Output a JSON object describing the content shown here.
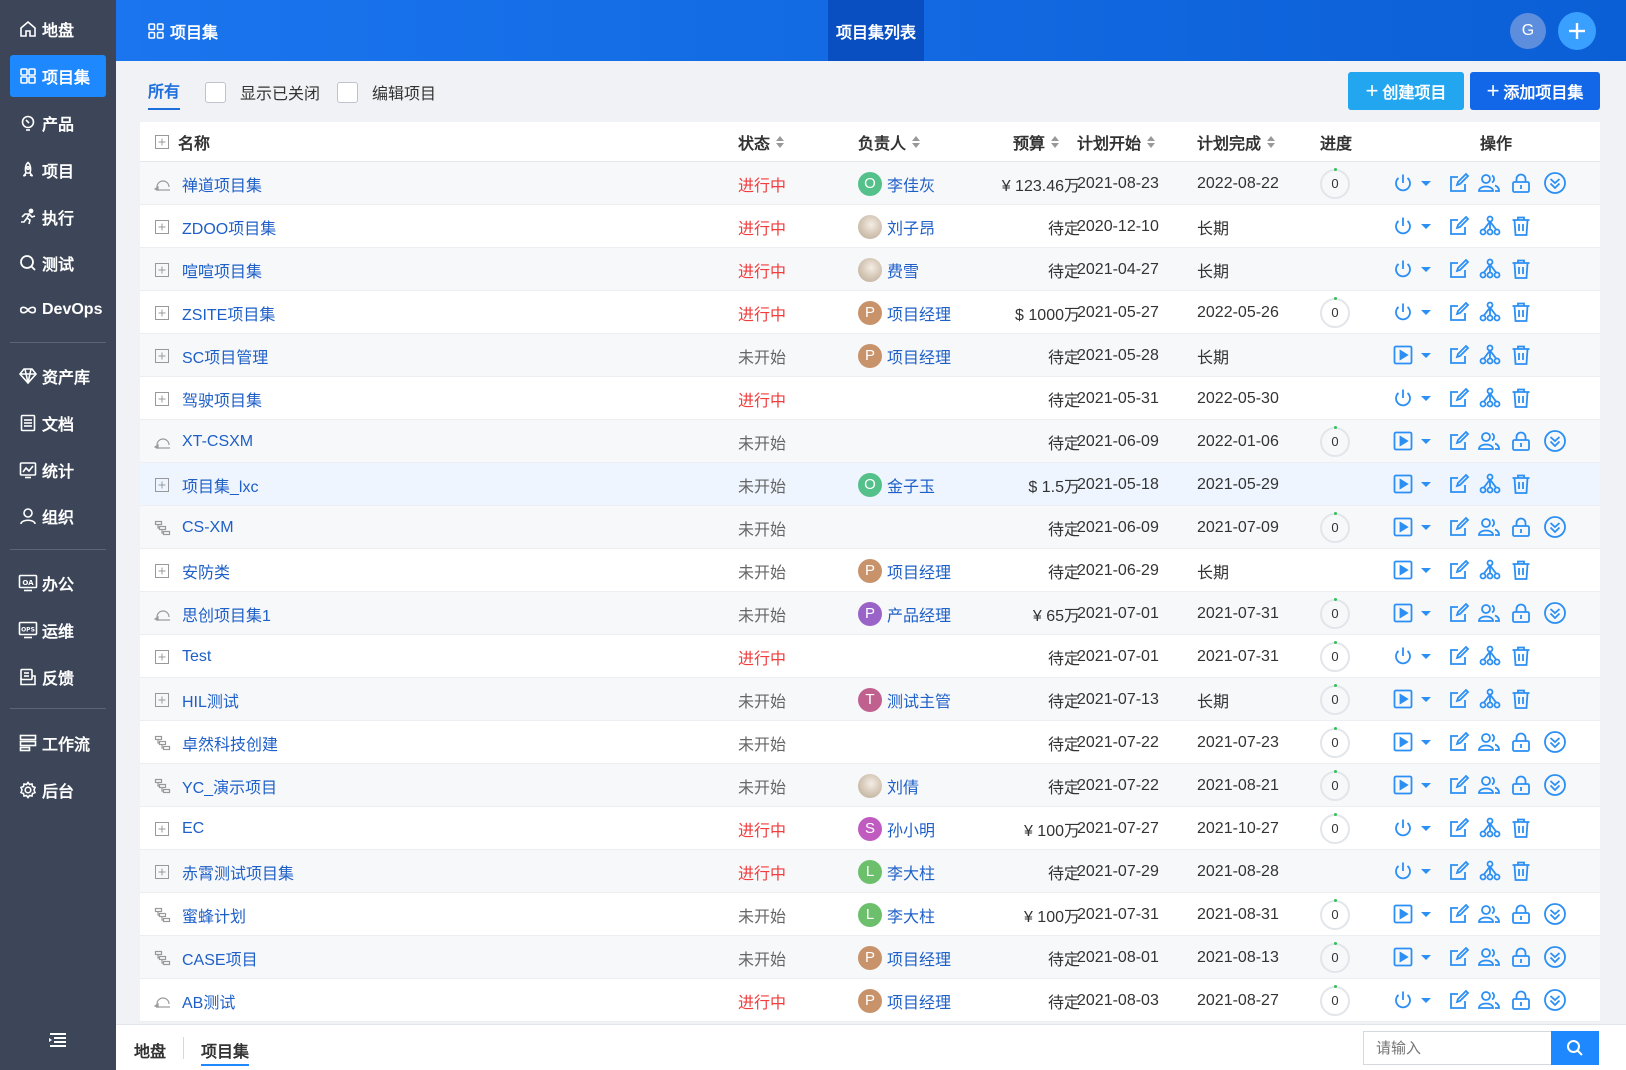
{
  "sidebar": {
    "items": [
      {
        "label": "地盘",
        "icon": "home-icon"
      },
      {
        "label": "项目集",
        "icon": "grid-icon",
        "active": true
      },
      {
        "label": "产品",
        "icon": "lightbulb-icon"
      },
      {
        "label": "项目",
        "icon": "rocket-icon"
      },
      {
        "label": "执行",
        "icon": "run-icon"
      },
      {
        "label": "测试",
        "icon": "magnifier-icon"
      },
      {
        "label": "DevOps",
        "icon": "infinity-icon"
      },
      {
        "label": "资产库",
        "icon": "diamond-icon"
      },
      {
        "label": "文档",
        "icon": "document-icon"
      },
      {
        "label": "统计",
        "icon": "chart-icon"
      },
      {
        "label": "组织",
        "icon": "user-icon"
      },
      {
        "label": "办公",
        "icon": "oa-icon"
      },
      {
        "label": "运维",
        "icon": "ops-icon"
      },
      {
        "label": "反馈",
        "icon": "feedback-icon"
      },
      {
        "label": "工作流",
        "icon": "workflow-icon"
      },
      {
        "label": "后台",
        "icon": "gear-icon"
      }
    ]
  },
  "header": {
    "breadcrumb": "项目集",
    "title": "项目集列表",
    "avatar_initial": "G"
  },
  "toolbar": {
    "tab_all": "所有",
    "show_closed": "显示已关闭",
    "edit_project": "编辑项目",
    "create_project": "创建项目",
    "add_program": "添加项目集"
  },
  "table": {
    "columns": {
      "name": "名称",
      "status": "状态",
      "owner": "负责人",
      "budget": "预算",
      "start": "计划开始",
      "end": "计划完成",
      "progress": "进度",
      "actions": "操作"
    },
    "rows": [
      {
        "icon": "sprint",
        "name": "禅道项目集",
        "status": "进行中",
        "owner": "李佳灰",
        "owner_avatar": "O",
        "avatar_color": "#54c08a",
        "budget": "¥ 123.46万",
        "start": "2021-08-23",
        "end": "2022-08-22",
        "progress": "0",
        "state": "running",
        "kind": "project"
      },
      {
        "icon": "program",
        "name": "ZDOO项目集",
        "status": "进行中",
        "owner": "刘子昂",
        "owner_avatar": "",
        "avatar_color": "photo",
        "budget": "待定",
        "start": "2020-12-10",
        "end": "长期",
        "progress": "",
        "state": "running",
        "kind": "program"
      },
      {
        "icon": "program",
        "name": "喧喧项目集",
        "status": "进行中",
        "owner": "费雪",
        "owner_avatar": "",
        "avatar_color": "photo",
        "budget": "待定",
        "start": "2021-04-27",
        "end": "长期",
        "progress": "",
        "state": "running",
        "kind": "program"
      },
      {
        "icon": "program",
        "name": "ZSITE项目集",
        "status": "进行中",
        "owner": "项目经理",
        "owner_avatar": "P",
        "avatar_color": "#c8926b",
        "budget": "$ 1000万",
        "start": "2021-05-27",
        "end": "2022-05-26",
        "progress": "0",
        "state": "running",
        "kind": "program"
      },
      {
        "icon": "program",
        "name": "SC项目管理",
        "status": "未开始",
        "owner": "项目经理",
        "owner_avatar": "P",
        "avatar_color": "#c8926b",
        "budget": "待定",
        "start": "2021-05-28",
        "end": "长期",
        "progress": "",
        "state": "wait",
        "kind": "program"
      },
      {
        "icon": "program",
        "name": "驾驶项目集",
        "status": "进行中",
        "owner": "",
        "owner_avatar": "",
        "avatar_color": "",
        "budget": "待定",
        "start": "2021-05-31",
        "end": "2022-05-30",
        "progress": "",
        "state": "running",
        "kind": "program"
      },
      {
        "icon": "sprint",
        "name": "XT-CSXM",
        "status": "未开始",
        "owner": "",
        "owner_avatar": "",
        "avatar_color": "",
        "budget": "待定",
        "start": "2021-06-09",
        "end": "2022-01-06",
        "progress": "0",
        "state": "wait",
        "kind": "project"
      },
      {
        "icon": "program",
        "name": "项目集_lxc",
        "status": "未开始",
        "owner": "金子玉",
        "owner_avatar": "O",
        "avatar_color": "#54c08a",
        "budget": "$ 1.5万",
        "start": "2021-05-18",
        "end": "2021-05-29",
        "progress": "",
        "state": "wait",
        "kind": "program"
      },
      {
        "icon": "waterfall",
        "name": "CS-XM",
        "status": "未开始",
        "owner": "",
        "owner_avatar": "",
        "avatar_color": "",
        "budget": "待定",
        "start": "2021-06-09",
        "end": "2021-07-09",
        "progress": "0",
        "state": "wait",
        "kind": "project"
      },
      {
        "icon": "program",
        "name": "安防类",
        "status": "未开始",
        "owner": "项目经理",
        "owner_avatar": "P",
        "avatar_color": "#c8926b",
        "budget": "待定",
        "start": "2021-06-29",
        "end": "长期",
        "progress": "",
        "state": "wait",
        "kind": "program"
      },
      {
        "icon": "sprint",
        "name": "思创项目集1",
        "status": "未开始",
        "owner": "产品经理",
        "owner_avatar": "P",
        "avatar_color": "#9a63c8",
        "budget": "¥ 65万",
        "start": "2021-07-01",
        "end": "2021-07-31",
        "progress": "0",
        "state": "wait",
        "kind": "project"
      },
      {
        "icon": "program",
        "name": "Test",
        "status": "进行中",
        "owner": "",
        "owner_avatar": "",
        "avatar_color": "",
        "budget": "待定",
        "start": "2021-07-01",
        "end": "2021-07-31",
        "progress": "0",
        "state": "running",
        "kind": "program"
      },
      {
        "icon": "program",
        "name": "HIL测试",
        "status": "未开始",
        "owner": "测试主管",
        "owner_avatar": "T",
        "avatar_color": "#c0608e",
        "budget": "待定",
        "start": "2021-07-13",
        "end": "长期",
        "progress": "0",
        "state": "wait",
        "kind": "program"
      },
      {
        "icon": "waterfall",
        "name": "卓然科技创建",
        "status": "未开始",
        "owner": "",
        "owner_avatar": "",
        "avatar_color": "",
        "budget": "待定",
        "start": "2021-07-22",
        "end": "2021-07-23",
        "progress": "0",
        "state": "wait",
        "kind": "project"
      },
      {
        "icon": "waterfall",
        "name": "YC_演示项目",
        "status": "未开始",
        "owner": "刘倩",
        "owner_avatar": "",
        "avatar_color": "photo",
        "budget": "待定",
        "start": "2021-07-22",
        "end": "2021-08-21",
        "progress": "0",
        "state": "wait",
        "kind": "project"
      },
      {
        "icon": "program",
        "name": "EC",
        "status": "进行中",
        "owner": "孙小明",
        "owner_avatar": "S",
        "avatar_color": "#c05cc0",
        "budget": "¥ 100万",
        "start": "2021-07-27",
        "end": "2021-10-27",
        "progress": "0",
        "state": "running",
        "kind": "program"
      },
      {
        "icon": "program",
        "name": "赤霄测试项目集",
        "status": "进行中",
        "owner": "李大柱",
        "owner_avatar": "L",
        "avatar_color": "#6cc06c",
        "budget": "待定",
        "start": "2021-07-29",
        "end": "2021-08-28",
        "progress": "",
        "state": "running",
        "kind": "program"
      },
      {
        "icon": "waterfall",
        "name": "蜜蜂计划",
        "status": "未开始",
        "owner": "李大柱",
        "owner_avatar": "L",
        "avatar_color": "#6cc06c",
        "budget": "¥ 100万",
        "start": "2021-07-31",
        "end": "2021-08-31",
        "progress": "0",
        "state": "wait",
        "kind": "project"
      },
      {
        "icon": "waterfall",
        "name": "CASE项目",
        "status": "未开始",
        "owner": "项目经理",
        "owner_avatar": "P",
        "avatar_color": "#c8926b",
        "budget": "待定",
        "start": "2021-08-01",
        "end": "2021-08-13",
        "progress": "0",
        "state": "wait",
        "kind": "project"
      },
      {
        "icon": "sprint",
        "name": "AB测试",
        "status": "进行中",
        "owner": "项目经理",
        "owner_avatar": "P",
        "avatar_color": "#c8926b",
        "budget": "待定",
        "start": "2021-08-03",
        "end": "2021-08-27",
        "progress": "0",
        "state": "running",
        "kind": "project"
      }
    ]
  },
  "footer": {
    "crumb_home": "地盘",
    "crumb_current": "项目集",
    "search_placeholder": "请输入"
  },
  "colors": {
    "sidebar_bg": "#3c4658",
    "accent": "#1e88ff",
    "status_running": "#f23d3d",
    "link": "#1e5fc8"
  }
}
